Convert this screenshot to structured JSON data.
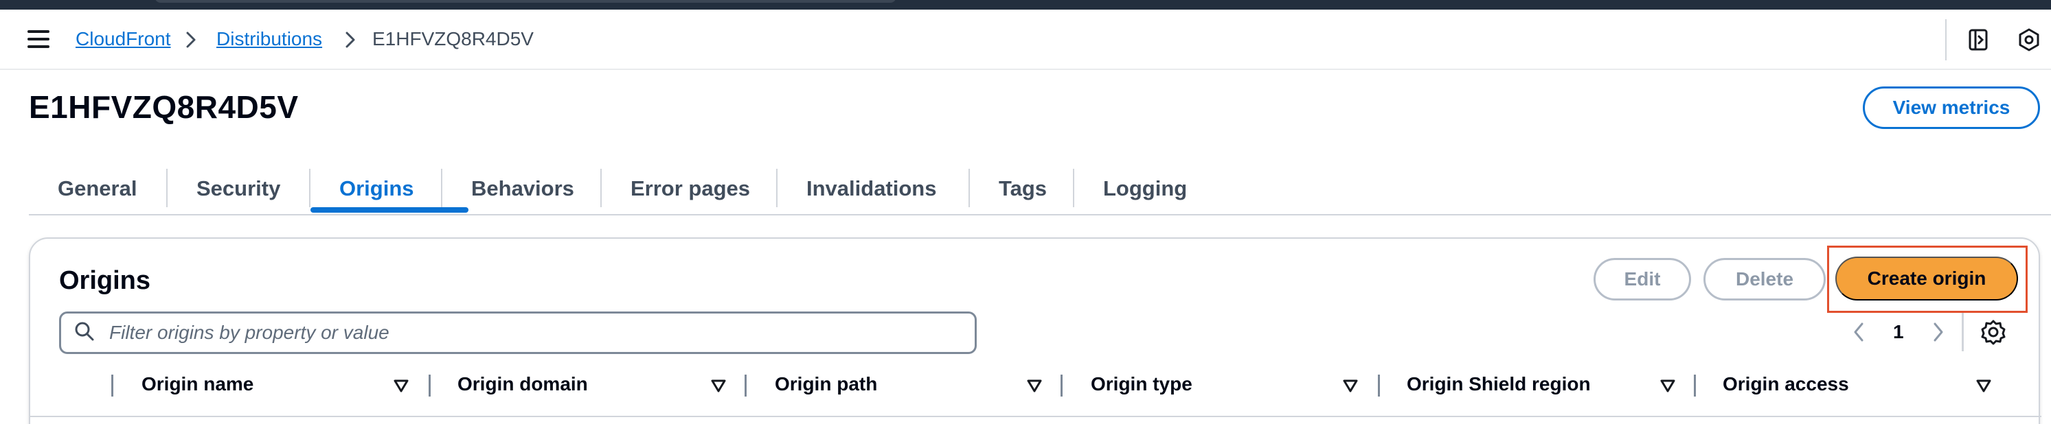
{
  "breadcrumb": [
    {
      "label": "CloudFront",
      "link": true
    },
    {
      "label": "Distributions",
      "link": true
    },
    {
      "label": "E1HFVZQ8R4D5V",
      "link": false
    }
  ],
  "header": {
    "title": "E1HFVZQ8R4D5V",
    "view_metrics_label": "View metrics"
  },
  "tabs": [
    {
      "label": "General",
      "active": false
    },
    {
      "label": "Security",
      "active": false
    },
    {
      "label": "Origins",
      "active": true
    },
    {
      "label": "Behaviors",
      "active": false
    },
    {
      "label": "Error pages",
      "active": false
    },
    {
      "label": "Invalidations",
      "active": false
    },
    {
      "label": "Tags",
      "active": false
    },
    {
      "label": "Logging",
      "active": false
    }
  ],
  "origins_panel": {
    "title": "Origins",
    "edit_label": "Edit",
    "delete_label": "Delete",
    "create_label": "Create origin",
    "filter_placeholder": "Filter origins by property or value",
    "current_page": "1",
    "columns": [
      "Origin name",
      "Origin domain",
      "Origin path",
      "Origin type",
      "Origin Shield region",
      "Origin access"
    ]
  },
  "colors": {
    "link": "#0972d3",
    "primary_button": "#f5a13a",
    "highlight_box": "#e2502e",
    "topbar": "#232f3e"
  },
  "icons": [
    "menu-icon",
    "chevron-right-icon",
    "side-panel-icon",
    "hex-settings-icon",
    "search-icon",
    "chevron-left-icon",
    "gear-icon",
    "sort-down-icon"
  ]
}
